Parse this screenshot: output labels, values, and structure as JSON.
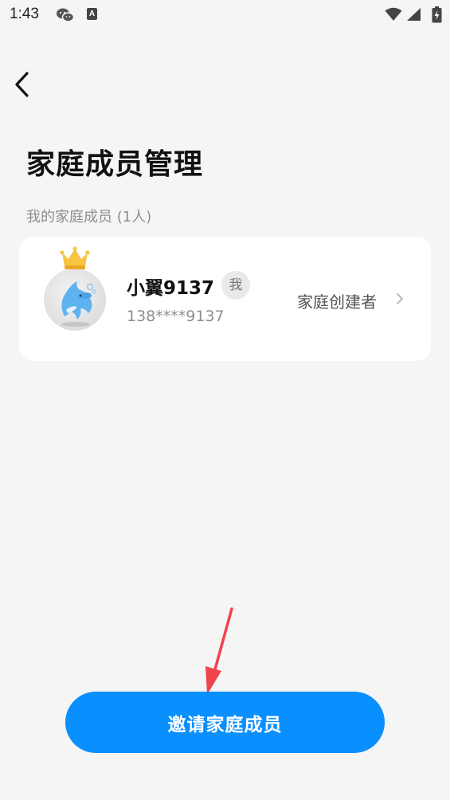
{
  "status_bar": {
    "time": "1:43",
    "icons": [
      "wechat-icon",
      "a-icon",
      "wifi-icon",
      "signal-icon",
      "battery-icon"
    ],
    "a_icon_label": "A"
  },
  "header": {
    "back_icon": "back-arrow-icon",
    "title": "家庭成员管理"
  },
  "members_section": {
    "label": "我的家庭成员 (1人)",
    "members": [
      {
        "name": "小翼9137",
        "badge": "我",
        "phone": "138****9137",
        "role": "家庭创建者",
        "avatar": "dolphin-avatar",
        "crown": "crown-icon"
      }
    ]
  },
  "invite_button": {
    "label": "邀请家庭成员"
  },
  "colors": {
    "background": "#f5f5f5",
    "card": "#ffffff",
    "accent": "#0a8fff",
    "annotation": "#f0444c",
    "muted_text": "#8e8e8e"
  }
}
